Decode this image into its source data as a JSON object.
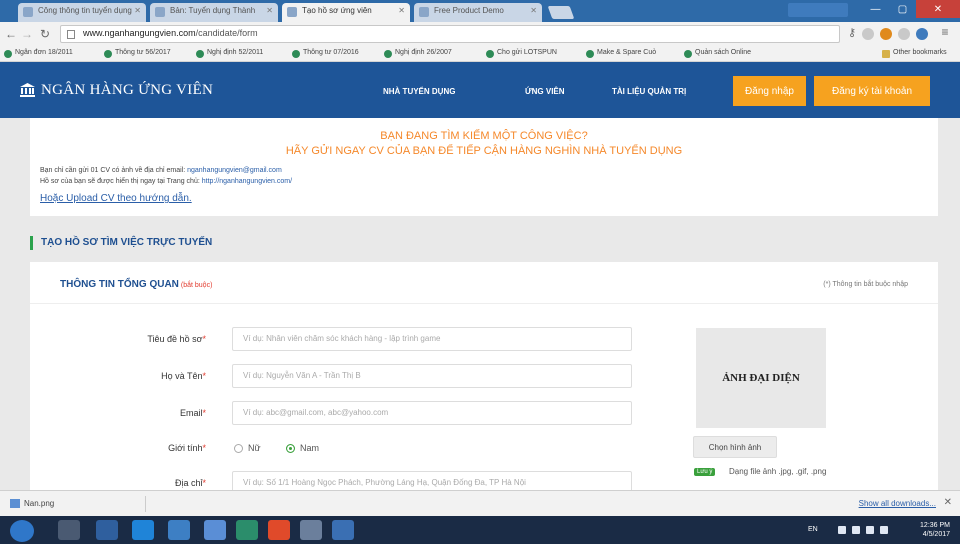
{
  "browser": {
    "tabs": [
      {
        "label": "Công thông tin tuyển dụng"
      },
      {
        "label": "Bản: Tuyển dụng Thành"
      },
      {
        "label": "Tạo hồ sơ ứng viên"
      },
      {
        "label": "Free Product Demo"
      }
    ],
    "url_host": "www.nganhangungvien.com",
    "url_path": "/candidate/form",
    "bookmarks": [
      "Ngân đơn 18/2011",
      "Thông tư 56/2017",
      "Nghị định 52/2011",
      "Thông tư 07/2016",
      "Nghị định 26/2007",
      "Cho gửi LOTSPUN",
      "Make & Spare Cuỏ",
      "Quản sách Online",
      "Other bookmarks"
    ]
  },
  "site": {
    "logo": "NGÂN HÀNG ỨNG VIÊN",
    "nav": {
      "employer": "NHÀ TUYỂN DỤNG",
      "candidate": "ỨNG VIÊN",
      "docs": "TÀI LIỆU QUẢN TRỊ"
    },
    "login": "Đăng nhập",
    "register": "Đăng ký tài khoản"
  },
  "notice": {
    "line1": "BẠN ĐANG TÌM KIẾM MỘT CÔNG VIỆC?",
    "line2": "HÃY GỬI NGAY CV CỦA BẠN ĐỂ TIẾP CẬN HÀNG NGHÌN NHÀ TUYỂN DỤNG",
    "line3_prefix": "Bạn chỉ cần gửi 01 CV có ảnh về địa chỉ email:",
    "line3_email": "nganhangungvien@gmail.com",
    "line4_prefix": "Hồ sơ của bạn sẽ được hiển thị ngay tại Trang chủ:",
    "line4_link": "http://nganhangungvien.com/",
    "upload_link": "Hoặc Upload CV theo hướng dẫn."
  },
  "section_title": "TẠO HỒ SƠ TÌM VIỆC TRỰC TUYẾN",
  "form": {
    "card_title": "THÔNG TIN TỔNG QUAN",
    "card_required": "(bắt buộc)",
    "card_note": "(*) Thông tin bắt buộc nhập",
    "fields": {
      "title": {
        "label": "Tiêu đề hồ sơ",
        "star": "*",
        "placeholder": "Ví dụ: Nhân viên chăm sóc khách hàng - lập trình game"
      },
      "name": {
        "label": "Họ và Tên",
        "star": "*",
        "placeholder": "Ví dụ: Nguyễn Văn A - Trần Thị B"
      },
      "email": {
        "label": "Email",
        "star": "*",
        "placeholder": "Ví dụ: abc@gmail.com, abc@yahoo.com"
      },
      "gender": {
        "label": "Giới tính",
        "star": "*",
        "female": "Nữ",
        "male": "Nam",
        "selected": "male"
      },
      "address": {
        "label": "Địa chỉ",
        "star": "*",
        "placeholder": "Ví dụ: Số 1/1 Hoàng Ngọc Phách, Phường Láng Hạ, Quận Đống Đa, TP Hà Nội"
      }
    },
    "avatar_label": "ẢNH ĐẠI DIỆN",
    "choose_photo": "Chọn hình ảnh",
    "format_badge": "Lưu ý",
    "format_text": "Dạng file ảnh .jpg, .gif, .png"
  },
  "downloads": {
    "item": "Nan.png",
    "show_all": "Show all downloads..."
  },
  "taskbar": {
    "lang": "EN",
    "time": "12:36 PM",
    "date": "4/5/2017"
  },
  "colors": {
    "header": "#1e5598",
    "accent": "#f6a21f",
    "notice": "#f5882a",
    "section": "#2ba24c"
  }
}
